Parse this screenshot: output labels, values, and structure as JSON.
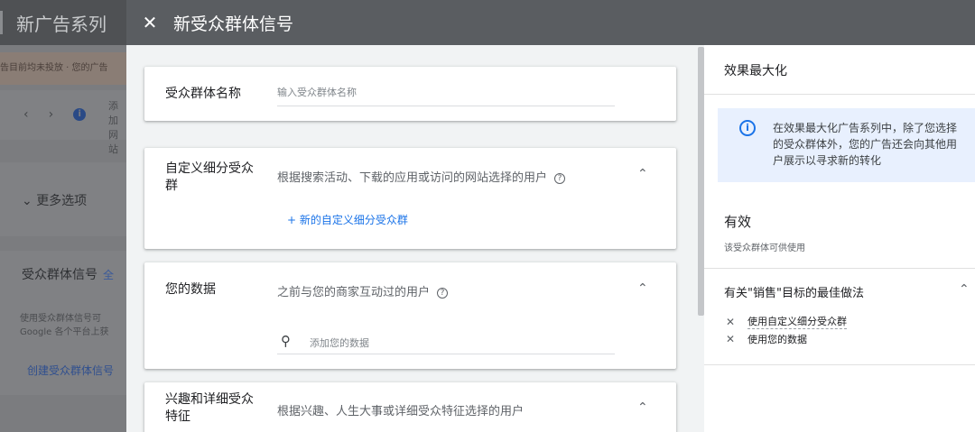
{
  "background": {
    "title": "新广告系列",
    "banner": "告目前均未投放 · 您的广告",
    "card_text_line1": "添加",
    "card_text_line2": "网站",
    "more_options": "更多选项",
    "signal_title": "受众群体信号",
    "signal_title_link": "全",
    "signal_desc_line1": "使用受众群体信号可",
    "signal_desc_line2": "Google 各个平台上获",
    "create_link": "创建受众群体信号"
  },
  "dialog": {
    "title": "新受众群体信号",
    "name_card": {
      "label": "受众群体名称",
      "placeholder": "输入受众群体名称"
    },
    "custom_card": {
      "label": "自定义细分受众群",
      "desc": "根据搜索活动、下载的应用或访问的网站选择的用户",
      "link": "+ 新的自定义细分受众群"
    },
    "data_card": {
      "label": "您的数据",
      "desc": "之前与您的商家互动过的用户",
      "search_placeholder": "添加您的数据"
    },
    "interest_card": {
      "label": "兴趣和详细受众特征",
      "desc": "根据兴趣、人生大事或详细受众特征选择的用户"
    }
  },
  "panel": {
    "title": "效果最大化",
    "info": "在效果最大化广告系列中，除了您选择的受众群体外，您的广告还会向其他用户展示以寻求新的转化",
    "status": "有效",
    "status_sub": "该受众群体可供使用",
    "best_practice_title": "有关\"销售\"目标的最佳做法",
    "items": [
      "使用自定义细分受众群",
      "使用您的数据"
    ]
  }
}
